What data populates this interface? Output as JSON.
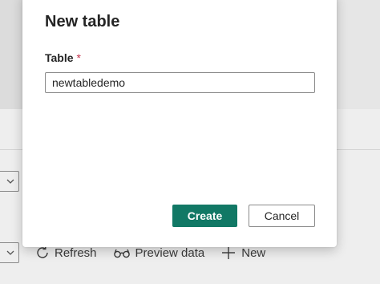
{
  "dialog": {
    "title": "New table",
    "field": {
      "label": "Table",
      "required_marker": "*",
      "value": "newtabledemo"
    },
    "buttons": {
      "create": "Create",
      "cancel": "Cancel"
    }
  },
  "toolbar": {
    "items": [
      {
        "label": "Refresh",
        "icon": "refresh-icon"
      },
      {
        "label": "Preview data",
        "icon": "glasses-icon"
      },
      {
        "label": "New",
        "icon": "plus-icon"
      }
    ]
  },
  "colors": {
    "primary": "#117865",
    "required": "#c4314b"
  }
}
